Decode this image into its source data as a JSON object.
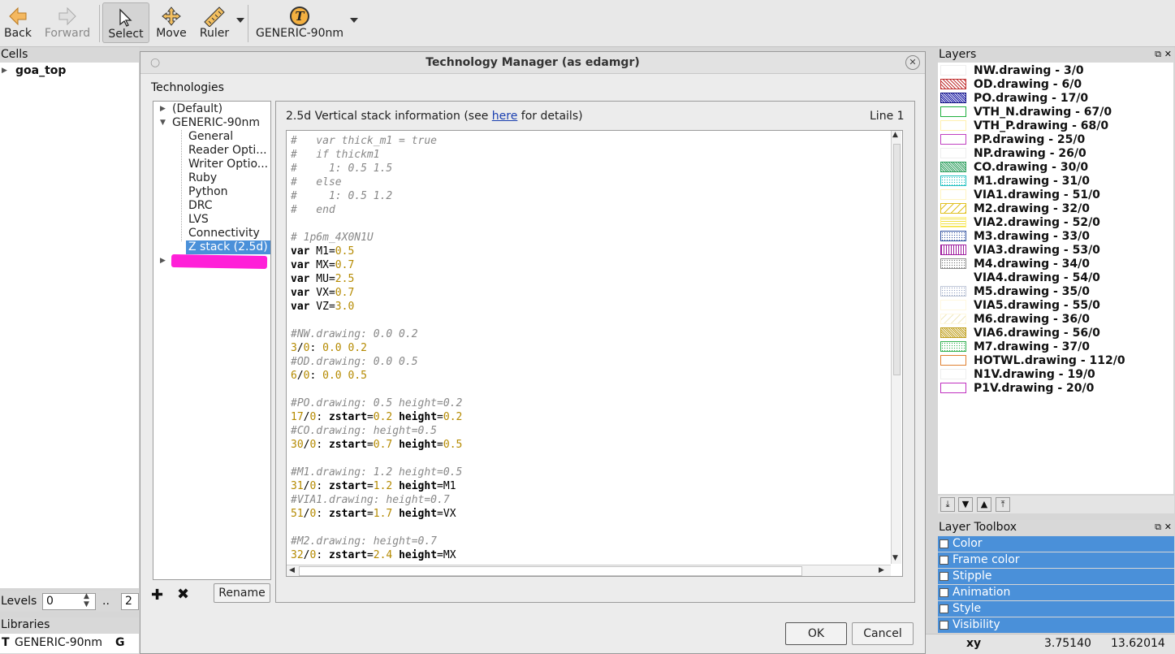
{
  "toolbar": {
    "back": "Back",
    "forward": "Forward",
    "select": "Select",
    "move": "Move",
    "ruler": "Ruler",
    "tech": "GENERIC-90nm",
    "tech_icon": "T"
  },
  "cells": {
    "title": "Cells",
    "top": "goa_top",
    "levels_label": "Levels",
    "levels_min": "0",
    "levels_sep": "..",
    "levels_max": "2"
  },
  "libraries": {
    "title": "Libraries",
    "type": "T",
    "name": "GENERIC-90nm",
    "flag": "G"
  },
  "dialog": {
    "title": "Technology Manager (as edamgr)",
    "technologies_label": "Technologies",
    "tree": {
      "default": "(Default)",
      "generic": "GENERIC-90nm",
      "children": [
        "General",
        "Reader Opti...",
        "Writer Optio...",
        "Ruby",
        "Python",
        "DRC",
        "LVS",
        "Connectivity",
        "Z stack (2.5d)"
      ]
    },
    "header_pre": "2.5d Vertical stack information (see ",
    "header_link": "here",
    "header_post": " for details)",
    "line_info": "Line 1",
    "rename": "Rename",
    "ok": "OK",
    "cancel": "Cancel",
    "code": [
      {
        "c": "#   var thick_m1 = true"
      },
      {
        "c": "#   if thickm1"
      },
      {
        "c": "#     1: 0.5 1.5"
      },
      {
        "c": "#   else"
      },
      {
        "c": "#     1: 0.5 1.2"
      },
      {
        "c": "#   end"
      },
      {},
      {
        "c": "# 1p6m_4X0N1U"
      },
      {
        "k": "var M1=",
        "n": "0.5"
      },
      {
        "k": "var MX=",
        "n": "0.7"
      },
      {
        "k": "var MU=",
        "n": "2.5"
      },
      {
        "k": "var VX=",
        "n": "0.7"
      },
      {
        "k": "var VZ=",
        "n": "3.0"
      },
      {},
      {
        "c": "#NW.drawing: 0.0 0.2"
      },
      {
        "l": "3",
        "v": "0.0 0.2"
      },
      {
        "c": "#OD.drawing: 0.0 0.5"
      },
      {
        "l": "6",
        "v": "0.0 0.5"
      },
      {},
      {
        "c": "#PO.drawing: 0.5 height=0.2"
      },
      {
        "l": "17",
        "z": "0.2",
        "h": "0.2"
      },
      {
        "c": "#CO.drawing: height=0.5"
      },
      {
        "l": "30",
        "z": "0.7",
        "h": "0.5"
      },
      {},
      {
        "c": "#M1.drawing: 1.2 height=0.5"
      },
      {
        "l": "31",
        "z": "1.2",
        "h": "M1"
      },
      {
        "c": "#VIA1.drawing: height=0.7"
      },
      {
        "l": "51",
        "z": "1.7",
        "h": "VX"
      },
      {},
      {
        "c": "#M2.drawing: height=0.7"
      },
      {
        "l": "32",
        "z": "2.4",
        "h": "MX"
      }
    ]
  },
  "layers": {
    "title": "Layers",
    "items": [
      {
        "label": "NW.drawing - 3/0",
        "color": "#ffffff",
        "border": "#eeeeee",
        "pattern": "none"
      },
      {
        "label": "OD.drawing - 6/0",
        "color": "#c03030",
        "border": "#c03030",
        "pattern": "hatch"
      },
      {
        "label": "PO.drawing - 17/0",
        "color": "#1010a0",
        "border": "#101080",
        "pattern": "dense"
      },
      {
        "label": "VTH_N.drawing - 67/0",
        "color": "#20b040",
        "border": "#20b040",
        "pattern": "none"
      },
      {
        "label": "VTH_P.drawing - 68/0",
        "color": "#ffffff",
        "border": "#fff0b0",
        "pattern": "none"
      },
      {
        "label": "PP.drawing - 25/0",
        "color": "#c040c0",
        "border": "#c040c0",
        "pattern": "none"
      },
      {
        "label": "NP.drawing - 26/0",
        "color": "#ffffff",
        "border": "#eeeeee",
        "pattern": "none"
      },
      {
        "label": "CO.drawing - 30/0",
        "color": "#30a060",
        "border": "#30a060",
        "pattern": "dense"
      },
      {
        "label": "M1.drawing - 31/0",
        "color": "#20c0c0",
        "border": "#20c0c0",
        "pattern": "dots"
      },
      {
        "label": "VIA1.drawing - 51/0",
        "color": "#ffffff",
        "border": "#fff4c0",
        "pattern": "none"
      },
      {
        "label": "M2.drawing - 32/0",
        "color": "#e0c020",
        "border": "#e0c020",
        "pattern": "diag"
      },
      {
        "label": "VIA2.drawing - 52/0",
        "color": "#f0e040",
        "border": "#fff080",
        "pattern": "hlines"
      },
      {
        "label": "M3.drawing - 33/0",
        "color": "#3050a0",
        "border": "#3050a0",
        "pattern": "dots"
      },
      {
        "label": "VIA3.drawing - 53/0",
        "color": "#a020a0",
        "border": "#a020a0",
        "pattern": "vlines"
      },
      {
        "label": "M4.drawing - 34/0",
        "color": "#707070",
        "border": "#909090",
        "pattern": "dots"
      },
      {
        "label": "VIA4.drawing - 54/0",
        "color": "#ffffff",
        "border": "#ffffff",
        "pattern": "none"
      },
      {
        "label": "M5.drawing - 35/0",
        "color": "#90a0c0",
        "border": "#c0c8d8",
        "pattern": "dots"
      },
      {
        "label": "VIA5.drawing - 55/0",
        "color": "#ffffff",
        "border": "#fff8e0",
        "pattern": "none"
      },
      {
        "label": "M6.drawing - 36/0",
        "color": "#f0e8c0",
        "border": "#fff8e0",
        "pattern": "diag"
      },
      {
        "label": "VIA6.drawing - 56/0",
        "color": "#c0a020",
        "border": "#c0a020",
        "pattern": "dense"
      },
      {
        "label": "M7.drawing - 37/0",
        "color": "#30b050",
        "border": "#30b050",
        "pattern": "dots"
      },
      {
        "label": "HOTWL.drawing - 112/0",
        "color": "#e08030",
        "border": "#e08030",
        "pattern": "none"
      },
      {
        "label": "N1V.drawing - 19/0",
        "color": "#ffffff",
        "border": "#eeeeee",
        "pattern": "none"
      },
      {
        "label": "P1V.drawing - 20/0",
        "color": "#c030c0",
        "border": "#c030c0",
        "pattern": "none"
      }
    ]
  },
  "toolbox": {
    "title": "Layer Toolbox",
    "items": [
      "Color",
      "Frame color",
      "Stipple",
      "Animation",
      "Style",
      "Visibility"
    ]
  },
  "status": {
    "mode": "xy",
    "x": "3.75140",
    "y": "13.62014"
  },
  "colors": {
    "accent": "#4a90d9",
    "redact": "#ff20d8"
  }
}
